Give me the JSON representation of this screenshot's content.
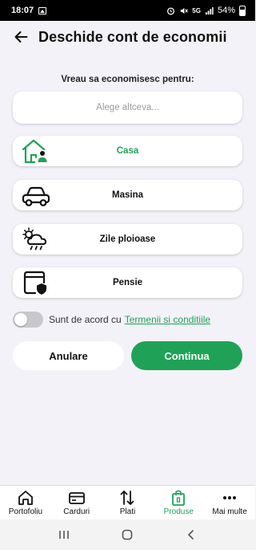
{
  "status_bar": {
    "time": "18:07",
    "network": "5G",
    "battery": "54%"
  },
  "header": {
    "title": "Deschide cont de economii",
    "back_icon": "arrow-left-icon"
  },
  "form": {
    "prompt": "Vreau sa economisesc pentru:",
    "custom_goal_placeholder": "Alege altceva..."
  },
  "options": [
    {
      "label": "Casa",
      "icon": "house-person-icon",
      "selected": true
    },
    {
      "label": "Masina",
      "icon": "car-icon",
      "selected": false
    },
    {
      "label": "Zile ploioase",
      "icon": "rain-cloud-icon",
      "selected": false
    },
    {
      "label": "Pensie",
      "icon": "calendar-shield-icon",
      "selected": false
    }
  ],
  "terms": {
    "agreement_text": "Sunt de acord cu",
    "link_text": "Termenii si conditiile",
    "accepted": false
  },
  "actions": {
    "cancel_label": "Anulare",
    "continue_label": "Continua"
  },
  "bottom_nav": [
    {
      "label": "Portofoliu",
      "icon": "home-icon",
      "active": false
    },
    {
      "label": "Carduri",
      "icon": "card-icon",
      "active": false
    },
    {
      "label": "Plati",
      "icon": "transfer-arrows-icon",
      "active": false
    },
    {
      "label": "Produse",
      "icon": "shopping-bag-icon",
      "active": true
    },
    {
      "label": "Mai multe",
      "icon": "more-dots-icon",
      "active": false
    }
  ],
  "colors": {
    "accent": "#1fa257",
    "background": "#f3f2f8",
    "toggle_off": "#c8c8cc"
  }
}
